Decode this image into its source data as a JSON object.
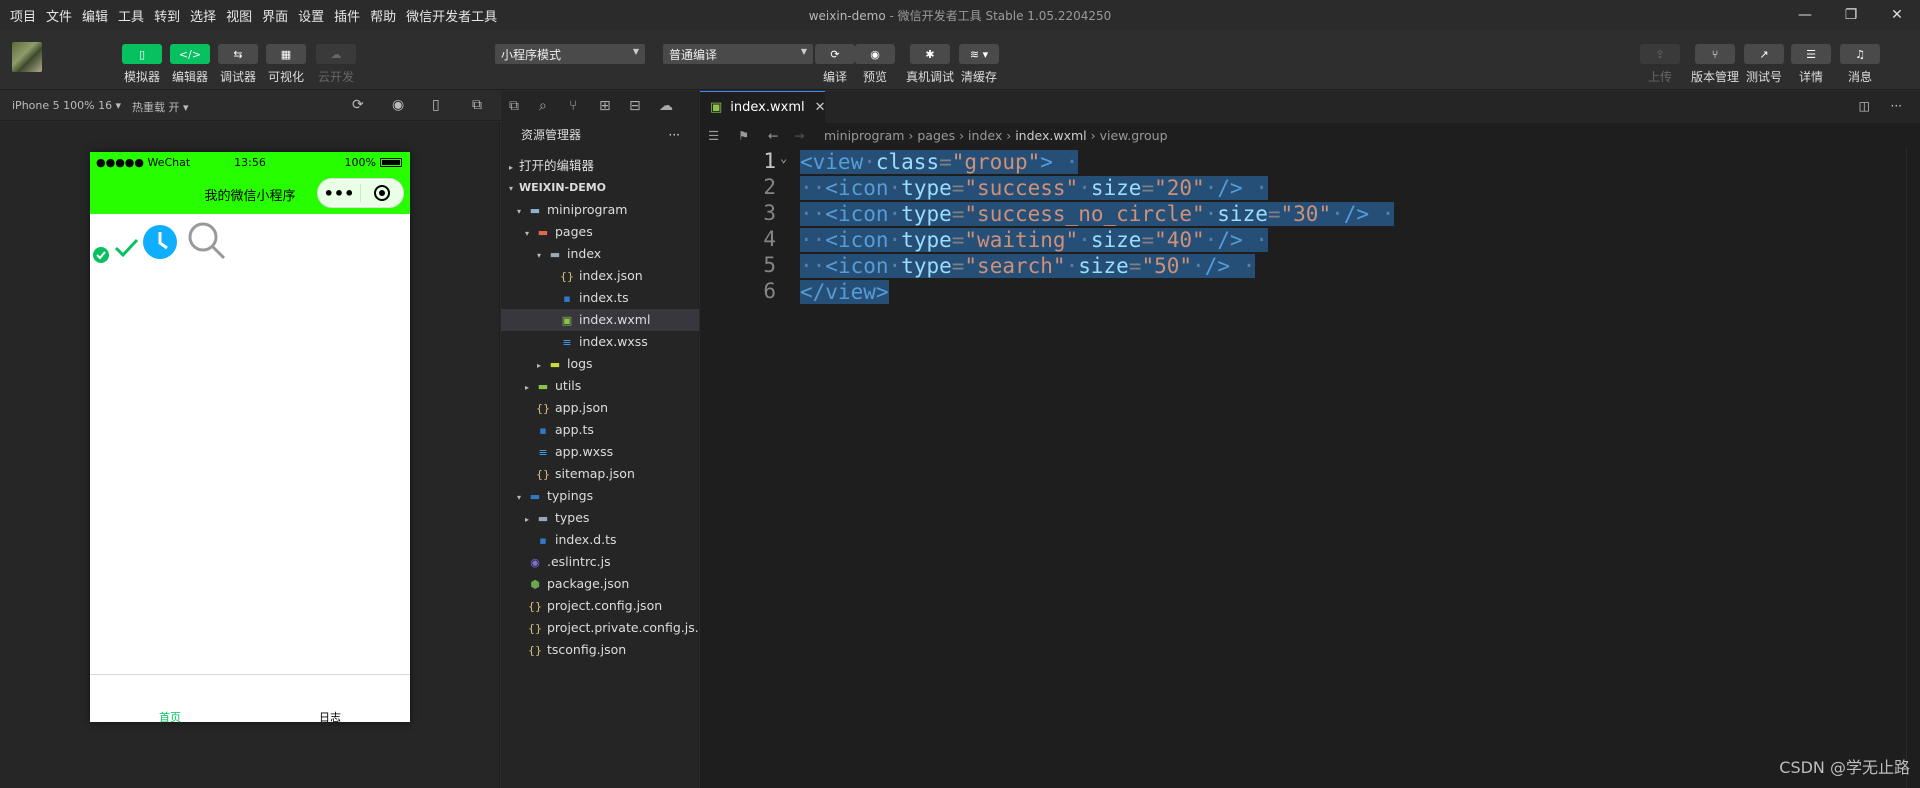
{
  "menu": [
    "项目",
    "文件",
    "编辑",
    "工具",
    "转到",
    "选择",
    "视图",
    "界面",
    "设置",
    "插件",
    "帮助",
    "微信开发者工具"
  ],
  "window_title": {
    "project": "weixin-demo",
    "app": "微信开发者工具 Stable 1.05.2204250"
  },
  "window_controls": [
    "—",
    "❐",
    "✕"
  ],
  "toolbar": {
    "left_buttons": [
      {
        "label": "模拟器",
        "icon": "phone-icon"
      },
      {
        "label": "编辑器",
        "icon": "code-icon"
      },
      {
        "label": "调试器",
        "icon": "debug-icon"
      },
      {
        "label": "可视化",
        "icon": "layout-icon"
      },
      {
        "label": "云开发",
        "icon": "cloud-icon"
      }
    ],
    "mode_select": "小程序模式",
    "compile_select": "普通编译",
    "mid_buttons": [
      {
        "label": "编译",
        "icon": "refresh-icon"
      },
      {
        "label": "预览",
        "icon": "eye-icon"
      },
      {
        "label": "真机调试",
        "icon": "bug-icon"
      },
      {
        "label": "清缓存",
        "icon": "layers-icon"
      }
    ],
    "right_buttons": [
      {
        "label": "上传",
        "icon": "upload-icon"
      },
      {
        "label": "版本管理",
        "icon": "branch-icon"
      },
      {
        "label": "测试号",
        "icon": "external-icon"
      },
      {
        "label": "详情",
        "icon": "menu-icon"
      },
      {
        "label": "消息",
        "icon": "bell-icon"
      }
    ]
  },
  "simulator": {
    "device": "iPhone 5 100% 16 ▾",
    "hot_reload": "热重载 开 ▾",
    "status": {
      "carrier": "●●●●● WeChat",
      "time": "13:56",
      "battery": "100%"
    },
    "nav_title": "我的微信小程序",
    "tabbar": [
      "首页",
      "日志"
    ],
    "colors": {
      "navbar": "#27ff00",
      "tab_active": "#07c160"
    }
  },
  "explorer": {
    "title": "资源管理器",
    "open_editors": "打开的编辑器",
    "project": "WEIXIN-DEMO",
    "tree": [
      {
        "name": "miniprogram",
        "depth": 1,
        "arrow": "▾",
        "icon": "folder-icon",
        "color": "#8fb0d0"
      },
      {
        "name": "pages",
        "depth": 2,
        "arrow": "▾",
        "icon": "folder-icon",
        "color": "#e0694f"
      },
      {
        "name": "index",
        "depth": 3,
        "arrow": "▾",
        "icon": "folder-icon",
        "color": "#9aa7b8"
      },
      {
        "name": "index.json",
        "depth": 4,
        "arrow": "",
        "icon": "json-icon",
        "color": "#e5c07b"
      },
      {
        "name": "index.ts",
        "depth": 4,
        "arrow": "",
        "icon": "ts-icon",
        "color": "#3178c6"
      },
      {
        "name": "index.wxml",
        "depth": 4,
        "arrow": "",
        "icon": "wxml-icon",
        "color": "#8bc34a",
        "selected": true
      },
      {
        "name": "index.wxss",
        "depth": 4,
        "arrow": "",
        "icon": "css-icon",
        "color": "#42a5f5"
      },
      {
        "name": "logs",
        "depth": 3,
        "arrow": "▸",
        "icon": "folder-icon",
        "color": "#cddc39"
      },
      {
        "name": "utils",
        "depth": 2,
        "arrow": "▸",
        "icon": "folder-icon",
        "color": "#8bc34a"
      },
      {
        "name": "app.json",
        "depth": 2,
        "arrow": "",
        "icon": "json-icon",
        "color": "#e5c07b"
      },
      {
        "name": "app.ts",
        "depth": 2,
        "arrow": "",
        "icon": "ts-icon",
        "color": "#3178c6"
      },
      {
        "name": "app.wxss",
        "depth": 2,
        "arrow": "",
        "icon": "css-icon",
        "color": "#42a5f5"
      },
      {
        "name": "sitemap.json",
        "depth": 2,
        "arrow": "",
        "icon": "json-icon",
        "color": "#e5c07b"
      },
      {
        "name": "typings",
        "depth": 1,
        "arrow": "▾",
        "icon": "folder-icon",
        "color": "#3178c6"
      },
      {
        "name": "types",
        "depth": 2,
        "arrow": "▸",
        "icon": "folder-icon",
        "color": "#9aa7b8"
      },
      {
        "name": "index.d.ts",
        "depth": 2,
        "arrow": "",
        "icon": "ts-icon",
        "color": "#3178c6"
      },
      {
        "name": ".eslintrc.js",
        "depth": 1,
        "arrow": "",
        "icon": "eslint-icon",
        "color": "#7c6fd6"
      },
      {
        "name": "package.json",
        "depth": 1,
        "arrow": "",
        "icon": "node-icon",
        "color": "#6aa84f"
      },
      {
        "name": "project.config.json",
        "depth": 1,
        "arrow": "",
        "icon": "json-icon",
        "color": "#e5c07b"
      },
      {
        "name": "project.private.config.js...",
        "depth": 1,
        "arrow": "",
        "icon": "json-icon",
        "color": "#e5c07b"
      },
      {
        "name": "tsconfig.json",
        "depth": 1,
        "arrow": "",
        "icon": "json-icon",
        "color": "#e5c07b"
      }
    ]
  },
  "editor": {
    "tab": "index.wxml",
    "breadcrumb": [
      "miniprogram",
      "pages",
      "index",
      "index.wxml",
      "view.group"
    ],
    "lines": [
      {
        "n": "1",
        "tokens": [
          [
            "tag",
            "<view"
          ],
          [
            "dot",
            "·"
          ],
          [
            "attr",
            "class"
          ],
          [
            "pun",
            "="
          ],
          [
            "str",
            "\"group\""
          ],
          [
            "tag",
            ">"
          ]
        ]
      },
      {
        "n": "2",
        "tokens": [
          [
            "dot",
            "··"
          ],
          [
            "tag",
            "<icon"
          ],
          [
            "dot",
            "·"
          ],
          [
            "attr",
            "type"
          ],
          [
            "pun",
            "="
          ],
          [
            "str",
            "\"success\""
          ],
          [
            "dot",
            "·"
          ],
          [
            "attr",
            "size"
          ],
          [
            "pun",
            "="
          ],
          [
            "str",
            "\"20\""
          ],
          [
            "dot",
            "·"
          ],
          [
            "tag",
            "/>"
          ]
        ]
      },
      {
        "n": "3",
        "tokens": [
          [
            "dot",
            "··"
          ],
          [
            "tag",
            "<icon"
          ],
          [
            "dot",
            "·"
          ],
          [
            "attr",
            "type"
          ],
          [
            "pun",
            "="
          ],
          [
            "str",
            "\"success_no_circle\""
          ],
          [
            "dot",
            "·"
          ],
          [
            "attr",
            "size"
          ],
          [
            "pun",
            "="
          ],
          [
            "str",
            "\"30\""
          ],
          [
            "dot",
            "·"
          ],
          [
            "tag",
            "/>"
          ]
        ]
      },
      {
        "n": "4",
        "tokens": [
          [
            "dot",
            "··"
          ],
          [
            "tag",
            "<icon"
          ],
          [
            "dot",
            "·"
          ],
          [
            "attr",
            "type"
          ],
          [
            "pun",
            "="
          ],
          [
            "str",
            "\"waiting\""
          ],
          [
            "dot",
            "·"
          ],
          [
            "attr",
            "size"
          ],
          [
            "pun",
            "="
          ],
          [
            "str",
            "\"40\""
          ],
          [
            "dot",
            "·"
          ],
          [
            "tag",
            "/>"
          ]
        ]
      },
      {
        "n": "5",
        "tokens": [
          [
            "dot",
            "··"
          ],
          [
            "tag",
            "<icon"
          ],
          [
            "dot",
            "·"
          ],
          [
            "attr",
            "type"
          ],
          [
            "pun",
            "="
          ],
          [
            "str",
            "\"search\""
          ],
          [
            "dot",
            "·"
          ],
          [
            "attr",
            "size"
          ],
          [
            "pun",
            "="
          ],
          [
            "str",
            "\"50\""
          ],
          [
            "dot",
            "·"
          ],
          [
            "tag",
            "/>"
          ]
        ]
      },
      {
        "n": "6",
        "tokens": [
          [
            "tag",
            "</view>"
          ]
        ]
      }
    ]
  },
  "watermark": "CSDN @学无止路"
}
